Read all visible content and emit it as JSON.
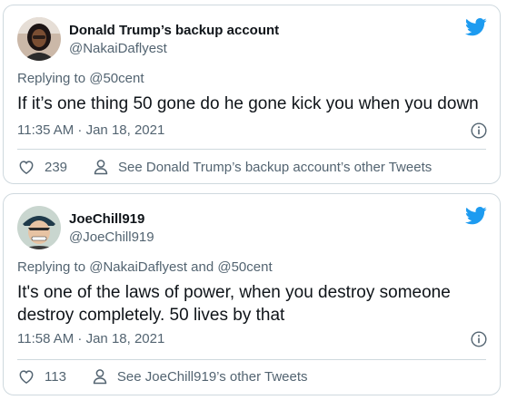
{
  "colors": {
    "twitter_blue": "#1d9bf0",
    "text_primary": "#0f1419",
    "text_secondary": "#536471",
    "border": "#cfd9de"
  },
  "tweets": [
    {
      "display_name": "Donald Trump’s backup account",
      "handle": "@NakaiDaflyest",
      "reply_prefix": "Replying to",
      "reply_to": "@50cent",
      "text": "If it’s one thing 50 gone do he gone kick you when you down",
      "timestamp": "11:35 AM · Jan 18, 2021",
      "likes": "239",
      "profile_link": "See Donald Trump’s backup account’s other Tweets",
      "icons": [
        "avatar",
        "twitter-bird-icon",
        "info-icon",
        "heart-icon",
        "person-icon"
      ]
    },
    {
      "display_name": "JoeChill919",
      "handle": "@JoeChill919",
      "reply_prefix": "Replying to",
      "reply_to": "@NakaiDaflyest and @50cent",
      "text": "It's one of the laws of power, when you destroy someone destroy completely. 50 lives by that",
      "timestamp": "11:58 AM · Jan 18, 2021",
      "likes": "113",
      "profile_link": "See JoeChill919’s other Tweets",
      "icons": [
        "avatar",
        "twitter-bird-icon",
        "info-icon",
        "heart-icon",
        "person-icon"
      ]
    }
  ]
}
